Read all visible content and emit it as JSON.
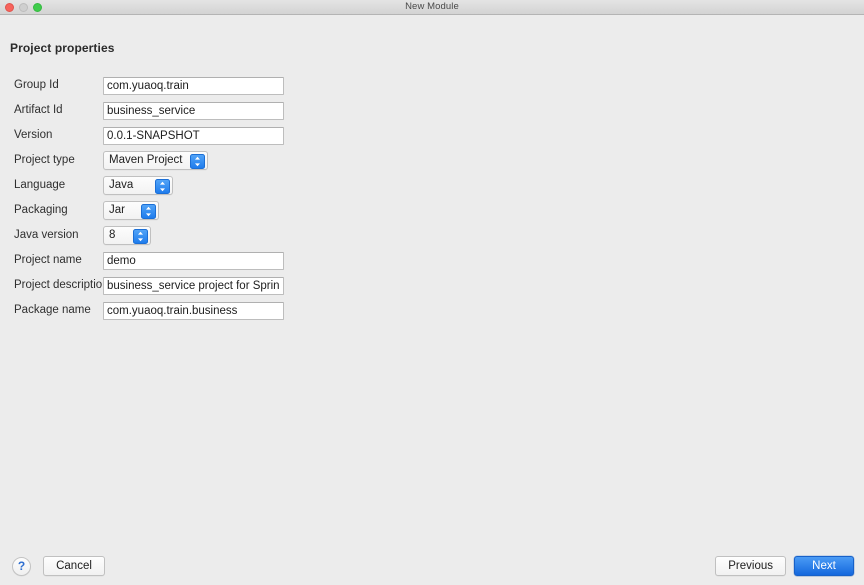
{
  "window": {
    "title": "New Module",
    "traffic_lights": [
      {
        "name": "close",
        "color": "#f7635c"
      },
      {
        "name": "minimize",
        "color": "#cfcfcf"
      },
      {
        "name": "zoom",
        "color": "#3fcc4b"
      }
    ]
  },
  "section": {
    "title": "Project properties"
  },
  "form": {
    "rows": [
      {
        "label": "Group Id",
        "type": "text",
        "value": "com.yuaoq.train",
        "placeholder": ""
      },
      {
        "label": "Artifact Id",
        "type": "text",
        "value": "business_service",
        "placeholder": ""
      },
      {
        "label": "Version",
        "type": "text",
        "value": "0.0.1-SNAPSHOT",
        "placeholder": ""
      },
      {
        "label": "Project type",
        "type": "popup",
        "value": "Maven Project",
        "placeholder": ""
      },
      {
        "label": "Language",
        "type": "popup",
        "value": "Java",
        "placeholder": ""
      },
      {
        "label": "Packaging",
        "type": "popup",
        "value": "Jar",
        "placeholder": ""
      },
      {
        "label": "Java version",
        "type": "popup",
        "value": "8",
        "placeholder": ""
      },
      {
        "label": "Project name",
        "type": "text",
        "value": "demo",
        "placeholder": ""
      },
      {
        "label": "Project description",
        "type": "text",
        "value": "business_service project for Spring Boot",
        "placeholder": ""
      },
      {
        "label": "Package name",
        "type": "text",
        "value": "com.yuaoq.train.business",
        "placeholder": ""
      }
    ]
  },
  "footer": {
    "help_label": "?",
    "cancel_label": "Cancel",
    "previous_label": "Previous",
    "next_label": "Next"
  },
  "colors": {
    "window_background": "#ececec",
    "titlebar": "#d9d9d9",
    "accent_blue": "#1f7ced",
    "default_button": "#2f86ee",
    "field_background": "#ffffff",
    "field_border": "#bdbdbd",
    "text": "#2f2f2f"
  }
}
